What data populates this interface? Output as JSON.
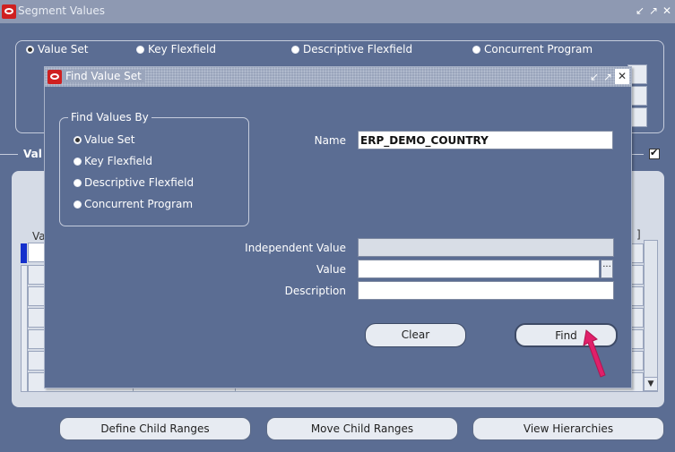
{
  "window": {
    "title": "Segment Values",
    "controls": [
      "minimize-icon",
      "maximize-icon",
      "close-icon"
    ]
  },
  "segment_type": {
    "options": [
      "Value Set",
      "Key Flexfield",
      "Descriptive Flexfield",
      "Concurrent Program"
    ],
    "selected": "Value Set"
  },
  "values_header": "Val",
  "grid": {
    "col_label": "Va",
    "bracket": "]"
  },
  "bottom_buttons": {
    "define_child_ranges": "Define Child Ranges",
    "move_child_ranges": "Move Child Ranges",
    "view_hierarchies": "View Hierarchies"
  },
  "dialog": {
    "title": "Find Value Set",
    "find_values_by": {
      "label": "Find Values By",
      "options": [
        "Value Set",
        "Key Flexfield",
        "Descriptive Flexfield",
        "Concurrent Program"
      ],
      "selected": "Value Set"
    },
    "name": {
      "label": "Name",
      "value": "ERP_DEMO_COUNTRY"
    },
    "independent_value": {
      "label": "Independent Value",
      "value": ""
    },
    "value": {
      "label": "Value",
      "value": ""
    },
    "description": {
      "label": "Description",
      "value": ""
    },
    "clear_label": "Clear",
    "find_label": "Find"
  },
  "colors": {
    "background": "#5b6d93",
    "oracle_red": "#cf2020",
    "pointer_arrow": "#e0206a"
  }
}
